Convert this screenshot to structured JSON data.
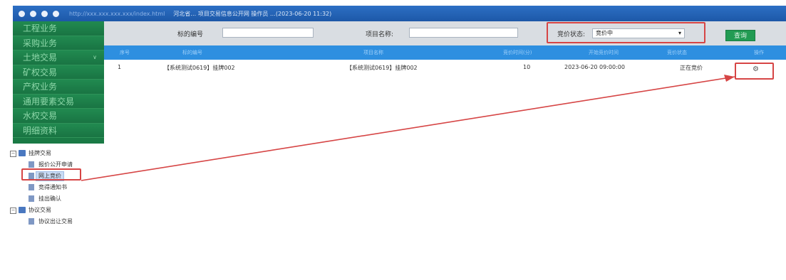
{
  "topbar": {
    "url": "http://xxx.xxx.xxx.xxx/index.html",
    "title": "河北省… 项目交易信息公开网 操作员 …(2023-06-20 11:32)"
  },
  "sidebar": {
    "items": [
      {
        "label": "工程业务"
      },
      {
        "label": "采购业务"
      },
      {
        "label": "土地交易",
        "caret": "∨"
      },
      {
        "label": "矿权交易"
      },
      {
        "label": "产权业务"
      },
      {
        "label": "通用要素交易"
      },
      {
        "label": "水权交易"
      },
      {
        "label": "明细资料"
      }
    ]
  },
  "tree": [
    {
      "toggle": "⊟",
      "label": "挂牌交易"
    },
    {
      "label": "报价公开申请"
    },
    {
      "label": "网上竞价"
    },
    {
      "label": "竞得通知书"
    },
    {
      "label": "挂出确认"
    },
    {
      "toggle": "⊟",
      "label": "协议交易"
    },
    {
      "label": "协议出让交易"
    }
  ],
  "search": {
    "project_no_label": "标的编号",
    "project_no_value": "",
    "project_name_label": "项目名称:",
    "project_name_value": "",
    "status_label": "竞价状态:",
    "status_value": "竞价中",
    "status_arrow": "▾",
    "query_button": "查询"
  },
  "table": {
    "headers": [
      "序号",
      "标的编号",
      "项目名称",
      "竞价时间(分)",
      "开始竞价时间",
      "竞价状态",
      "操作"
    ],
    "rows": [
      {
        "index": "1",
        "code": "【系统测试0619】",
        "code_suffix": "挂牌002",
        "project_name": "【系统测试0619】挂牌002",
        "minutes": "10",
        "start_time": "2023-06-20 09:00:00",
        "status": "正在竞价",
        "action_icon": "gear-icon"
      }
    ]
  },
  "colors": {
    "topbar": "#1d58a8",
    "sidebar": "#1a7a45",
    "table_header": "#2e8fe0",
    "highlight": "#d64545",
    "query_button": "#229b53"
  }
}
